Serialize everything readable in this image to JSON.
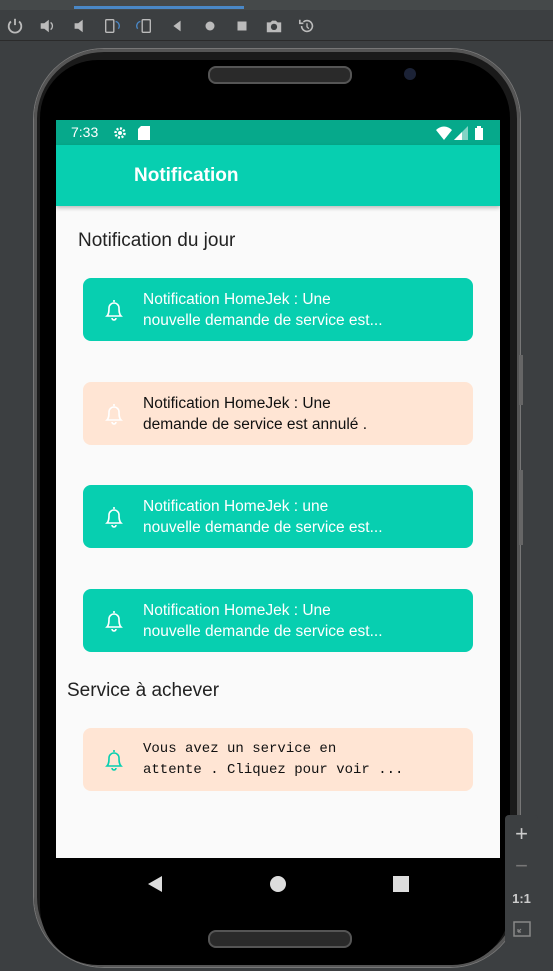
{
  "status_bar": {
    "time": "7:33"
  },
  "app_bar": {
    "title": "Notification"
  },
  "sections": {
    "today_title": "Notification du jour",
    "pending_title": "Service à achever"
  },
  "notifications": [
    {
      "line1": "Notification HomeJek :  Une",
      "line2": "nouvelle demande de service est...",
      "style": "green"
    },
    {
      "line1": "Notification HomeJek : Une",
      "line2": "demande de service est annulé .",
      "style": "peach"
    },
    {
      "line1": "Notification HomeJek : une",
      "line2": "nouvelle demande de service est...",
      "style": "green"
    },
    {
      "line1": "Notification HomeJek :  Une",
      "line2": "nouvelle demande de service est...",
      "style": "green"
    }
  ],
  "pending": {
    "line1": "Vous avez un service en",
    "line2": "attente . Cliquez pour voir ..."
  },
  "zoom_panel": {
    "plus": "+",
    "minus": "−",
    "ratio": "1:1"
  },
  "colors": {
    "accent": "#07cfb0",
    "status_bar": "#06a98b",
    "peach": "#ffe5d4"
  }
}
